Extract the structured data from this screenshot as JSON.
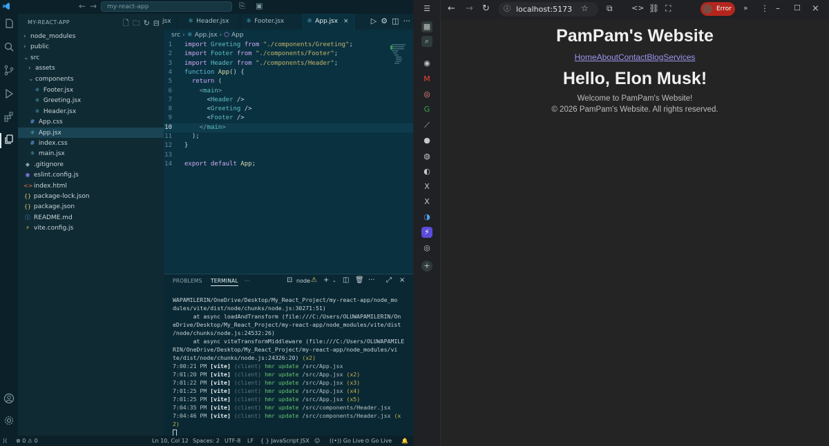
{
  "vscode": {
    "command_center": "my-react-app",
    "explorer_title": "MY-REACT-APP",
    "tree": [
      {
        "label": "node_modules",
        "type": "folder",
        "open": false
      },
      {
        "label": "public",
        "type": "folder",
        "open": false
      },
      {
        "label": "src",
        "type": "folder",
        "open": true
      },
      {
        "label": "assets",
        "type": "folder",
        "open": false
      },
      {
        "label": "components",
        "type": "folder",
        "open": true
      },
      {
        "label": "Footer.jsx",
        "type": "react"
      },
      {
        "label": "Greeting.jsx",
        "type": "react"
      },
      {
        "label": "Header.jsx",
        "type": "react"
      },
      {
        "label": "App.css",
        "type": "css"
      },
      {
        "label": "App.jsx",
        "type": "react",
        "selected": true
      },
      {
        "label": "index.css",
        "type": "css"
      },
      {
        "label": "main.jsx",
        "type": "react"
      },
      {
        "label": ".gitignore",
        "type": "git"
      },
      {
        "label": "eslint.config.js",
        "type": "eslint"
      },
      {
        "label": "index.html",
        "type": "html"
      },
      {
        "label": "package-lock.json",
        "type": "json"
      },
      {
        "label": "package.json",
        "type": "json"
      },
      {
        "label": "README.md",
        "type": "info"
      },
      {
        "label": "vite.config.js",
        "type": "vite"
      }
    ],
    "tabs": [
      {
        "label": "jsx"
      },
      {
        "label": "Header.jsx"
      },
      {
        "label": "Footer.jsx"
      },
      {
        "label": "App.jsx",
        "active": true
      }
    ],
    "breadcrumb": {
      "folder": "src",
      "file": "App.jsx",
      "symbol": "App"
    },
    "code_lines": [
      "import Greeting from \"./components/Greeting\";",
      "import Footer from \"./components/Footer\";",
      "import Header from \"./components/Header\";",
      "function App() {",
      "  return (",
      "    <main>",
      "      <Header />",
      "      <Greeting />",
      "      <Footer />",
      "    </main>",
      "  );",
      "}",
      "",
      "export default App;"
    ],
    "current_line": 10,
    "panel": {
      "tab_problems": "PROBLEMS",
      "tab_terminal": "TERMINAL",
      "more": "···",
      "terminal_name": "node"
    },
    "terminal_plain": [
      "WAPAMILERIN/OneDrive/Desktop/My_React_Project/my-react-app/node_mo",
      "dules/vite/dist/node/chunks/node.js:30271:51)",
      "      at async loadAndTransform (file:///C:/Users/OLUWAPAMILERIN/On",
      "eDrive/Desktop/My_React_Project/my-react-app/node_modules/vite/dist",
      "/node/chunks/node.js:24532:26)",
      "      at async viteTransformMiddleware (file:///C:/Users/OLUWAPAMILE",
      "RIN/OneDrive/Desktop/My_React_Project/my-react-app/node_modules/vi"
    ],
    "terminal_tail_text": "te/dist/node/chunks/node.js:24326:20)",
    "terminal_tail_count": "(x2)",
    "terminal_hmr": [
      {
        "time": "7:00:21 PM",
        "path": "/src/App.jsx",
        "count": ""
      },
      {
        "time": "7:01:20 PM",
        "path": "/src/App.jsx",
        "count": "(x2)"
      },
      {
        "time": "7:01:22 PM",
        "path": "/src/App.jsx",
        "count": "(x3)"
      },
      {
        "time": "7:01:25 PM",
        "path": "/src/App.jsx",
        "count": "(x4)"
      },
      {
        "time": "7:01:25 PM",
        "path": "/src/App.jsx",
        "count": "(x5)"
      },
      {
        "time": "7:04:35 PM",
        "path": "/src/components/Header.jsx",
        "count": ""
      },
      {
        "time": "7:04:46 PM",
        "path": "/src/components/Header.jsx",
        "count": "(x"
      }
    ],
    "terminal_wrap": "2)",
    "vite_tag": "[vite]",
    "client_tag": "(client)",
    "hmr_text": "hmr update",
    "status": {
      "errors": "0",
      "warnings": "0",
      "position": "Ln 10, Col 12",
      "spaces": "Spaces: 2",
      "encoding": "UTF-8",
      "eol": "LF",
      "language": "JavaScript JSX",
      "go_live_1": "Go Live",
      "go_live_2": "Go Live"
    }
  },
  "browser": {
    "url": "localhost:5173",
    "profile_status": "Error",
    "site_title": "PamPam's Website",
    "nav": [
      "Home",
      "About",
      "Contact",
      "Blog",
      "Services"
    ],
    "greeting": "Hello, Elon Musk!",
    "welcome": "Welcome to PamPam's Website!",
    "footer": "© 2026 PamPam's Website. All rights reserved."
  }
}
